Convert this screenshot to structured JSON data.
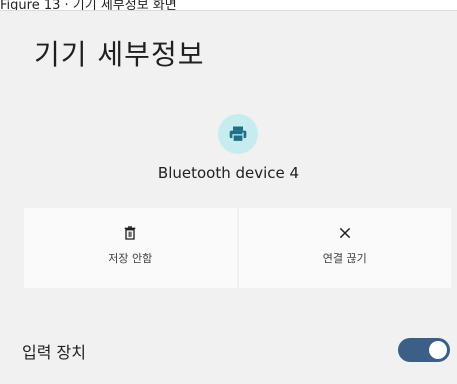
{
  "caption": "Figure 13 · 기기 세부정보 화면",
  "page": {
    "title": "기기 세부정보"
  },
  "device": {
    "name": "Bluetooth device 4",
    "icon": "printer-icon",
    "icon_bg_color": "#c7ecef",
    "icon_color": "#1f6f86"
  },
  "actions": [
    {
      "label": "저장 안함",
      "icon": "trash-icon"
    },
    {
      "label": "연결 끊기",
      "icon": "close-icon"
    }
  ],
  "settings": {
    "input_device": {
      "label": "입력 장치",
      "enabled": true,
      "toggle_color": "#3b5f86"
    }
  }
}
